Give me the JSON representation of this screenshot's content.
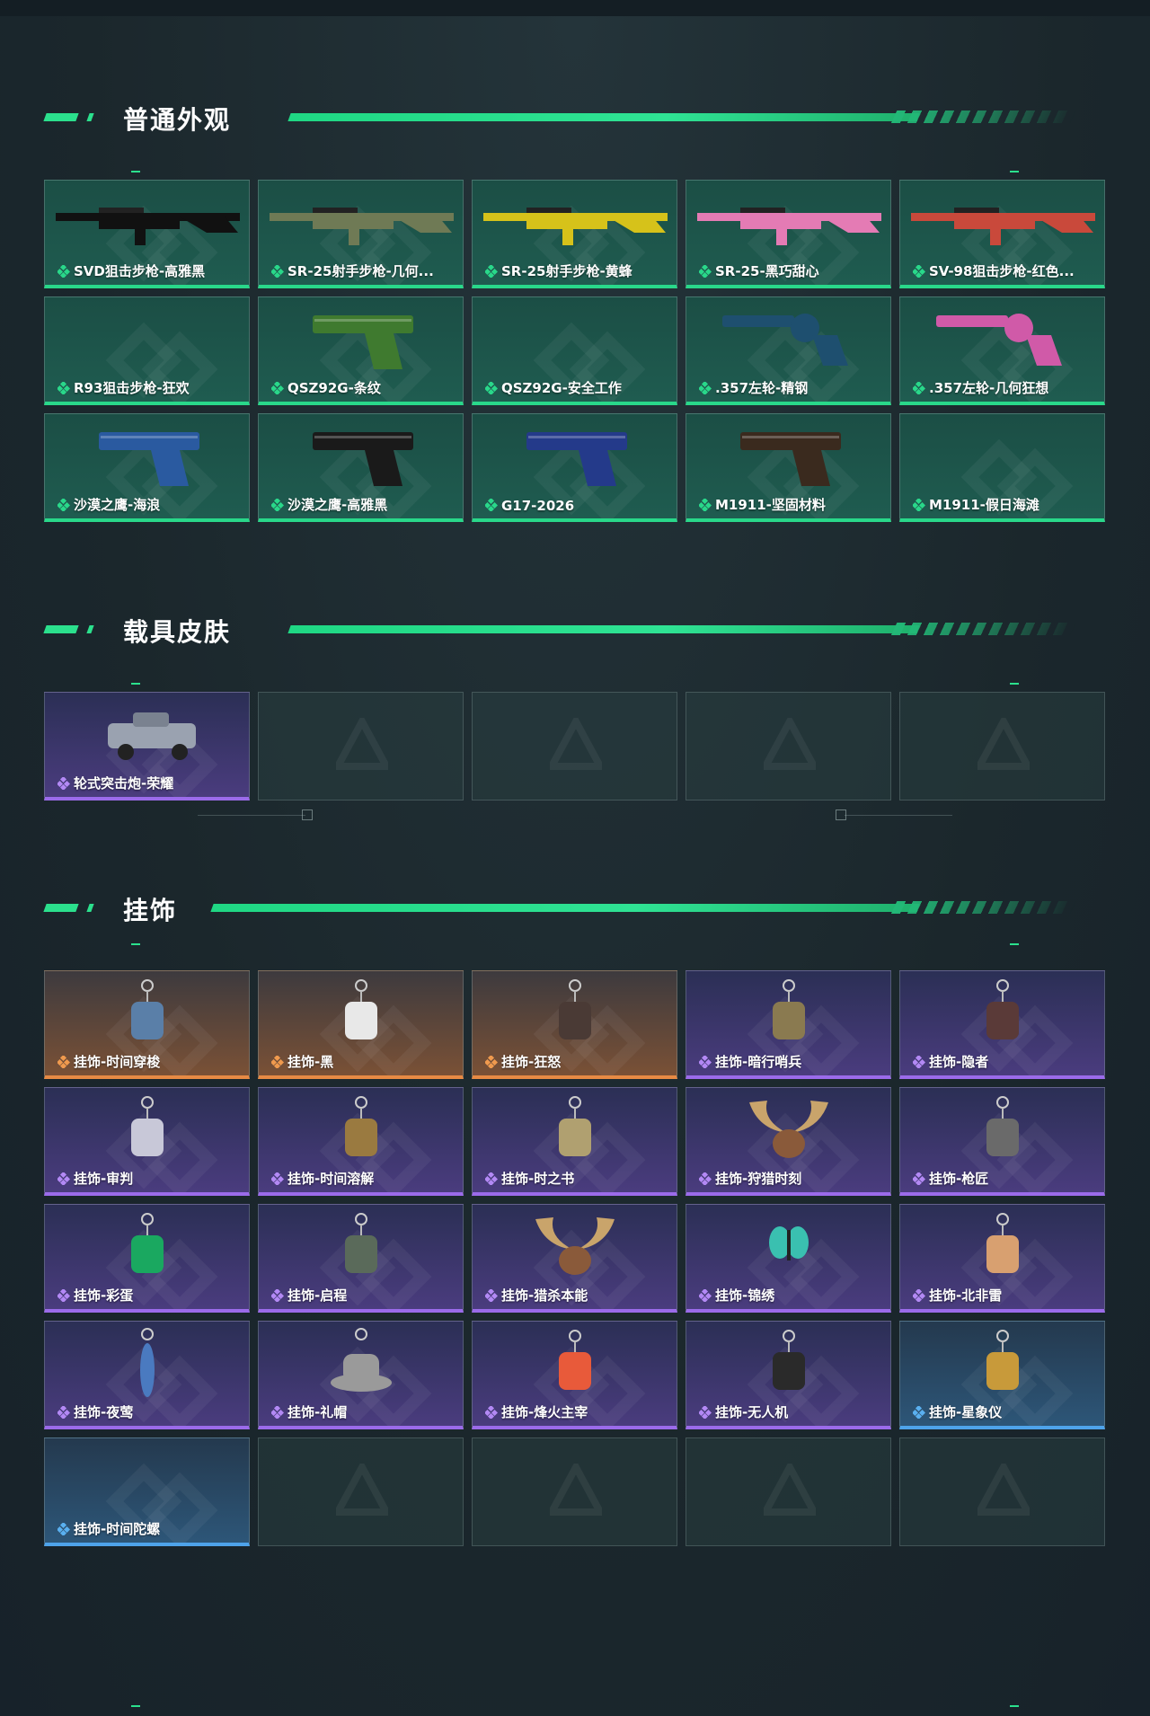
{
  "sections": {
    "weapons": {
      "title": "普通外观",
      "items": [
        {
          "label": "SVD狙击步枪-高雅黑",
          "rarity": "green",
          "icon": "rifle-icon",
          "color": "#111111"
        },
        {
          "label": "SR-25射手步枪-几何...",
          "rarity": "green",
          "icon": "rifle-icon",
          "color": "#6f7a55"
        },
        {
          "label": "SR-25射手步枪-黄蜂",
          "rarity": "green",
          "icon": "rifle-icon",
          "color": "#d6c21a"
        },
        {
          "label": "SR-25-黑巧甜心",
          "rarity": "green",
          "icon": "rifle-icon",
          "color": "#e47bb4"
        },
        {
          "label": "SV-98狙击步枪-红色...",
          "rarity": "green",
          "icon": "rifle-icon",
          "color": "#c9493b"
        },
        {
          "label": "R93狙击步枪-狂欢",
          "rarity": "green",
          "icon": "",
          "color": ""
        },
        {
          "label": "QSZ92G-条纹",
          "rarity": "green",
          "icon": "pistol-icon",
          "color": "#3f7a2f"
        },
        {
          "label": "QSZ92G-安全工作",
          "rarity": "green",
          "icon": "",
          "color": ""
        },
        {
          "label": ".357左轮-精钢",
          "rarity": "green",
          "icon": "revolver-icon",
          "color": "#1e4f6f"
        },
        {
          "label": ".357左轮-几何狂想",
          "rarity": "green",
          "icon": "revolver-icon",
          "color": "#d05aa8"
        },
        {
          "label": "沙漠之鹰-海浪",
          "rarity": "green",
          "icon": "pistol-icon",
          "color": "#2a5aa0"
        },
        {
          "label": "沙漠之鹰-高雅黑",
          "rarity": "green",
          "icon": "pistol-icon",
          "color": "#1a1a1a"
        },
        {
          "label": "G17-2026",
          "rarity": "green",
          "icon": "pistol-icon",
          "color": "#243a8a"
        },
        {
          "label": "M1911-坚固材料",
          "rarity": "green",
          "icon": "pistol-icon",
          "color": "#3a2a1e"
        },
        {
          "label": "M1911-假日海滩",
          "rarity": "green",
          "icon": "",
          "color": ""
        }
      ]
    },
    "vehicles": {
      "title": "载具皮肤",
      "items": [
        {
          "label": "轮式突击炮-荣耀",
          "rarity": "purple",
          "icon": "vehicle-icon",
          "color": "#9aa2b0"
        },
        {
          "label": "",
          "rarity": "empty",
          "icon": "",
          "color": ""
        },
        {
          "label": "",
          "rarity": "empty",
          "icon": "",
          "color": ""
        },
        {
          "label": "",
          "rarity": "empty",
          "icon": "",
          "color": ""
        },
        {
          "label": "",
          "rarity": "empty",
          "icon": "",
          "color": ""
        }
      ]
    },
    "charms": {
      "title": "挂饰",
      "items": [
        {
          "label": "挂饰-时间穿梭",
          "rarity": "orange",
          "icon": "charm-icon",
          "color": "#5a7fa8"
        },
        {
          "label": "挂饰-黑",
          "rarity": "orange",
          "icon": "charm-icon",
          "color": "#e8e8e8"
        },
        {
          "label": "挂饰-狂怒",
          "rarity": "orange",
          "icon": "charm-icon",
          "color": "#4a3a35"
        },
        {
          "label": "挂饰-暗行哨兵",
          "rarity": "purple",
          "icon": "charm-icon",
          "color": "#8a7a50"
        },
        {
          "label": "挂饰-隐者",
          "rarity": "purple",
          "icon": "charm-icon",
          "color": "#5a3a38"
        },
        {
          "label": "挂饰-审判",
          "rarity": "purple",
          "icon": "charm-icon",
          "color": "#c8c8d8"
        },
        {
          "label": "挂饰-时间溶解",
          "rarity": "purple",
          "icon": "charm-icon",
          "color": "#9a7a40"
        },
        {
          "label": "挂饰-时之书",
          "rarity": "purple",
          "icon": "charm-icon",
          "color": "#b0a070"
        },
        {
          "label": "挂饰-狩猎时刻",
          "rarity": "purple",
          "icon": "antler-icon",
          "color": "#c9a46b"
        },
        {
          "label": "挂饰-枪匠",
          "rarity": "purple",
          "icon": "charm-icon",
          "color": "#6a6a6a"
        },
        {
          "label": "挂饰-彩蛋",
          "rarity": "purple",
          "icon": "charm-icon",
          "color": "#1aa860"
        },
        {
          "label": "挂饰-启程",
          "rarity": "purple",
          "icon": "charm-icon",
          "color": "#5a6a5a"
        },
        {
          "label": "挂饰-猎杀本能",
          "rarity": "purple",
          "icon": "antler-icon",
          "color": "#c9a46b"
        },
        {
          "label": "挂饰-锦绣",
          "rarity": "purple",
          "icon": "butterfly-icon",
          "color": "#3ac0b0"
        },
        {
          "label": "挂饰-北非雷",
          "rarity": "purple",
          "icon": "charm-icon",
          "color": "#d8a070"
        },
        {
          "label": "挂饰-夜莺",
          "rarity": "purple",
          "icon": "feather-icon",
          "color": "#4a7ac0"
        },
        {
          "label": "挂饰-礼帽",
          "rarity": "purple",
          "icon": "hat-icon",
          "color": "#9a9a9a"
        },
        {
          "label": "挂饰-烽火主宰",
          "rarity": "purple",
          "icon": "charm-icon",
          "color": "#e85a3a"
        },
        {
          "label": "挂饰-无人机",
          "rarity": "purple",
          "icon": "charm-icon",
          "color": "#2a2a2a"
        },
        {
          "label": "挂饰-星象仪",
          "rarity": "blue",
          "icon": "charm-icon",
          "color": "#c89a3a"
        },
        {
          "label": "挂饰-时间陀螺",
          "rarity": "blue",
          "icon": "",
          "color": ""
        },
        {
          "label": "",
          "rarity": "empty",
          "icon": "",
          "color": ""
        },
        {
          "label": "",
          "rarity": "empty",
          "icon": "",
          "color": ""
        },
        {
          "label": "",
          "rarity": "empty",
          "icon": "",
          "color": ""
        },
        {
          "label": "",
          "rarity": "empty",
          "icon": "",
          "color": ""
        }
      ]
    }
  },
  "colors": {
    "accent": "#2be08d",
    "green_rarity": "#29d88a",
    "purple_rarity": "#9b6bea",
    "orange_rarity": "#e78a44",
    "blue_rarity": "#4ea3ea"
  }
}
